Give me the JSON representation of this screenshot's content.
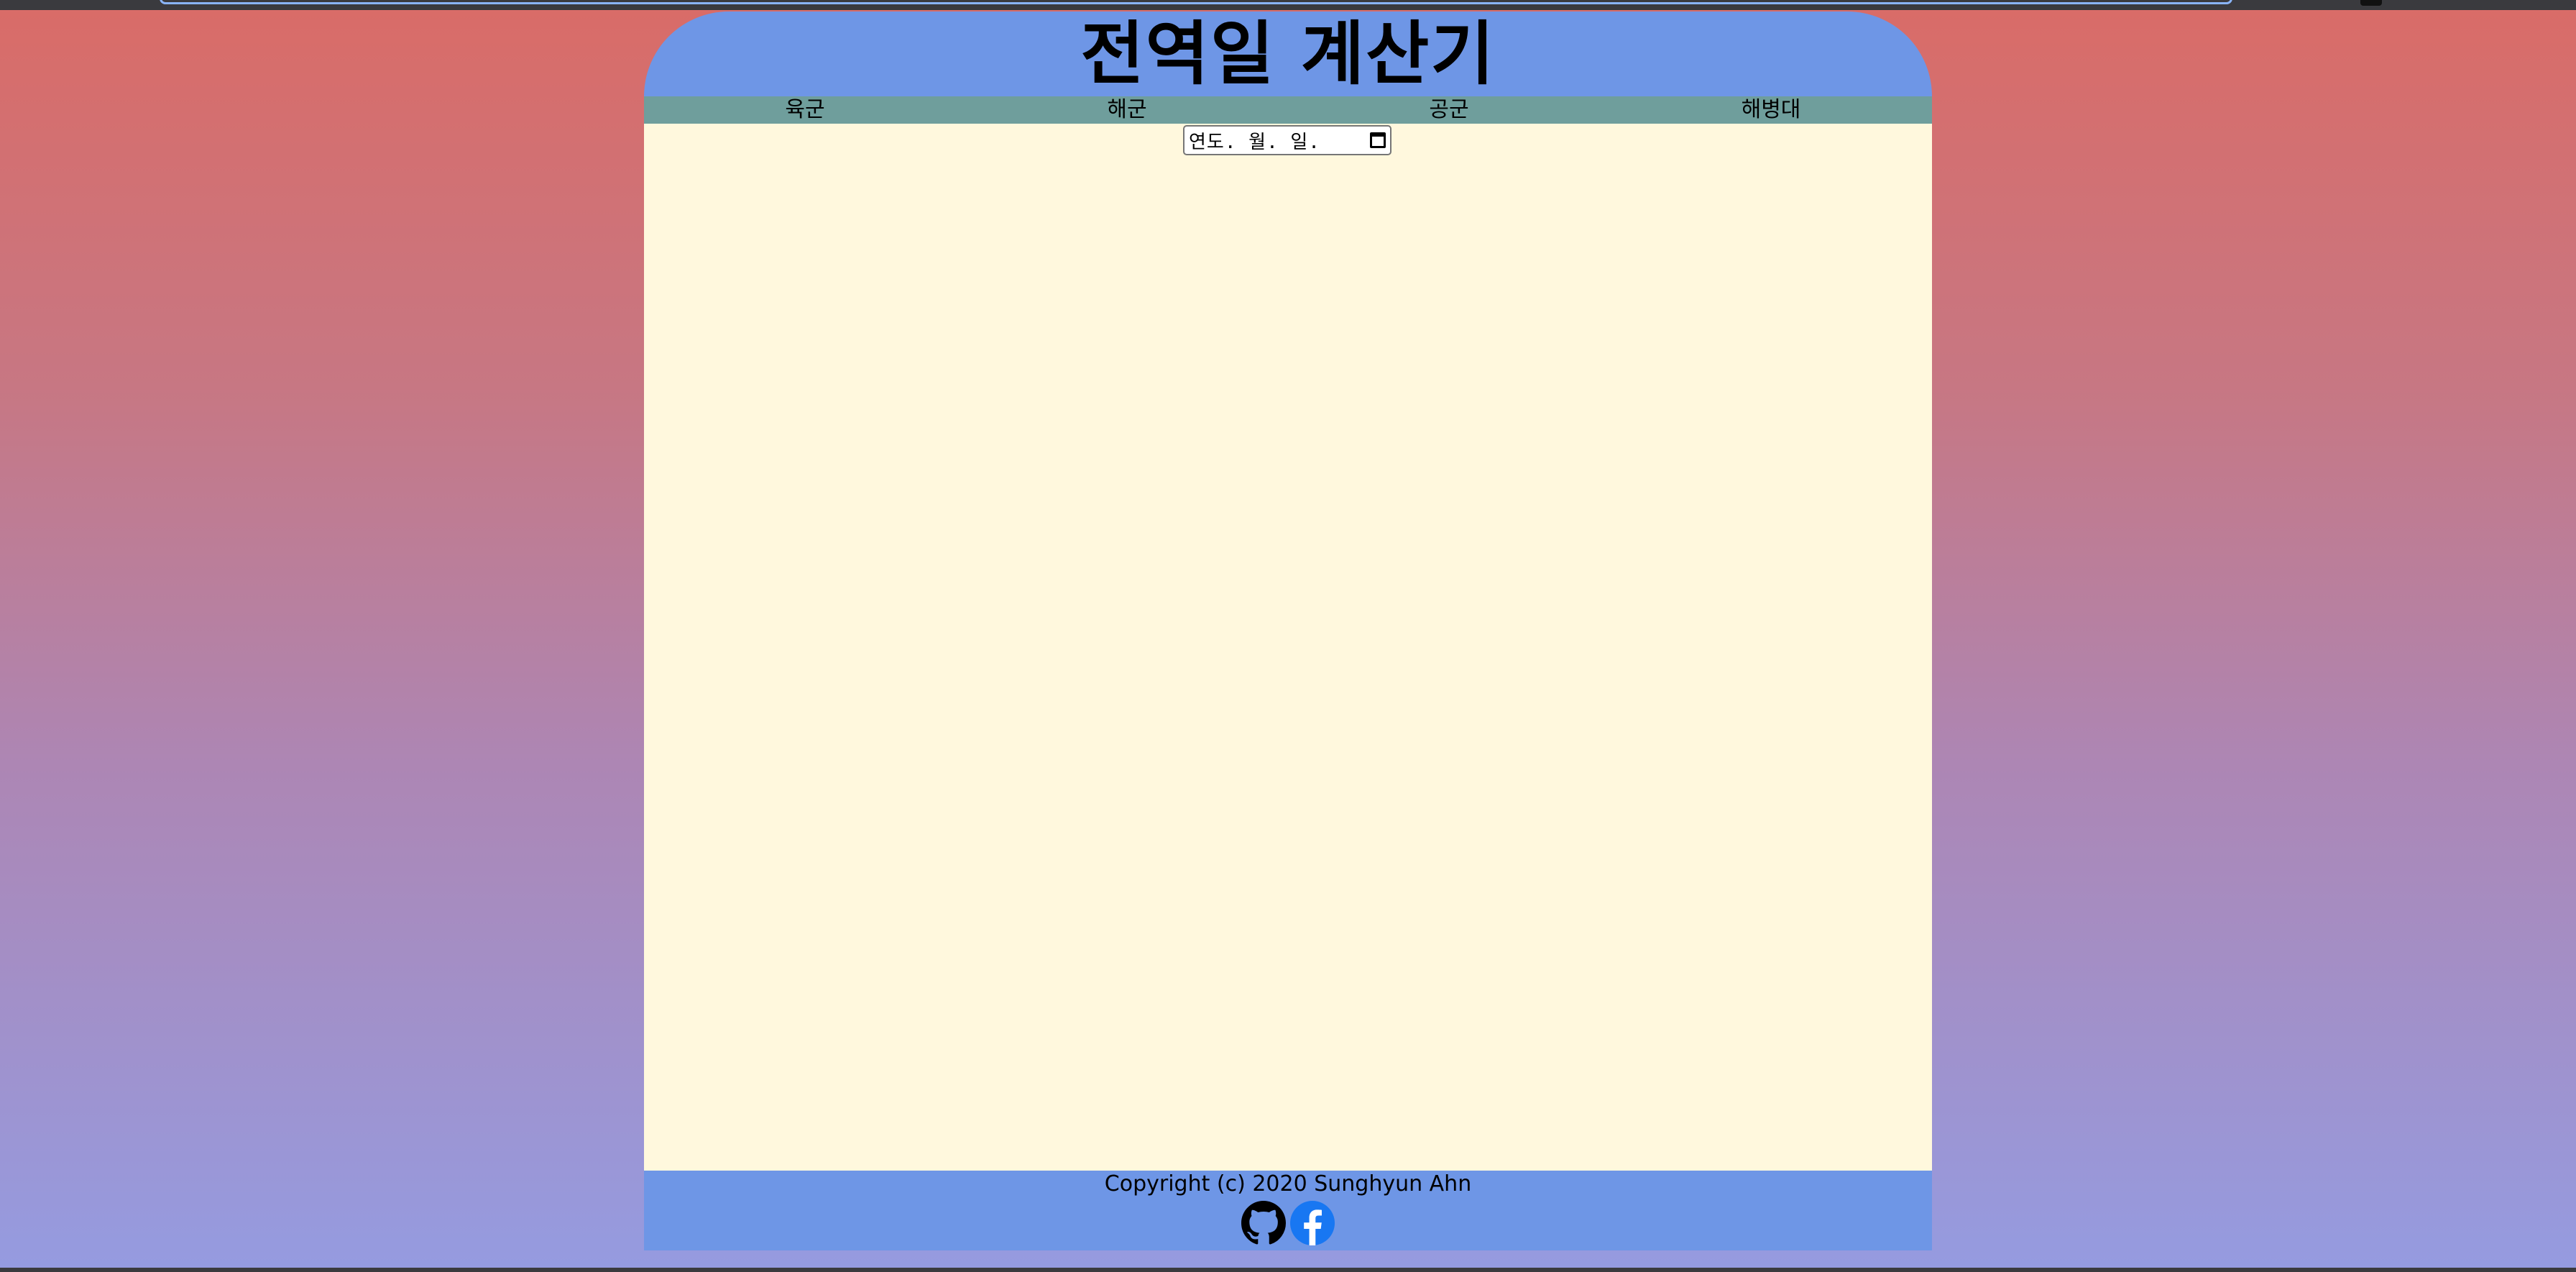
{
  "header": {
    "title": "전역일 계산기"
  },
  "nav": {
    "items": [
      {
        "label": "육군"
      },
      {
        "label": "해군"
      },
      {
        "label": "공군"
      },
      {
        "label": "해병대"
      }
    ]
  },
  "date_input": {
    "display": "연도. 월. 일.",
    "icon": "calendar-icon"
  },
  "footer": {
    "copyright": "Copyright (c) 2020 Sunghyun Ahn",
    "icons": [
      "github-icon",
      "facebook-icon"
    ]
  },
  "colors": {
    "header_bg": "#6e96e6",
    "nav_bg": "#6f9e9c",
    "content_bg": "#fff8dd",
    "footer_bg": "#6e96e6",
    "gradient_top": "#d96c68",
    "gradient_bottom": "#959be0",
    "facebook_blue": "#1877f2"
  }
}
